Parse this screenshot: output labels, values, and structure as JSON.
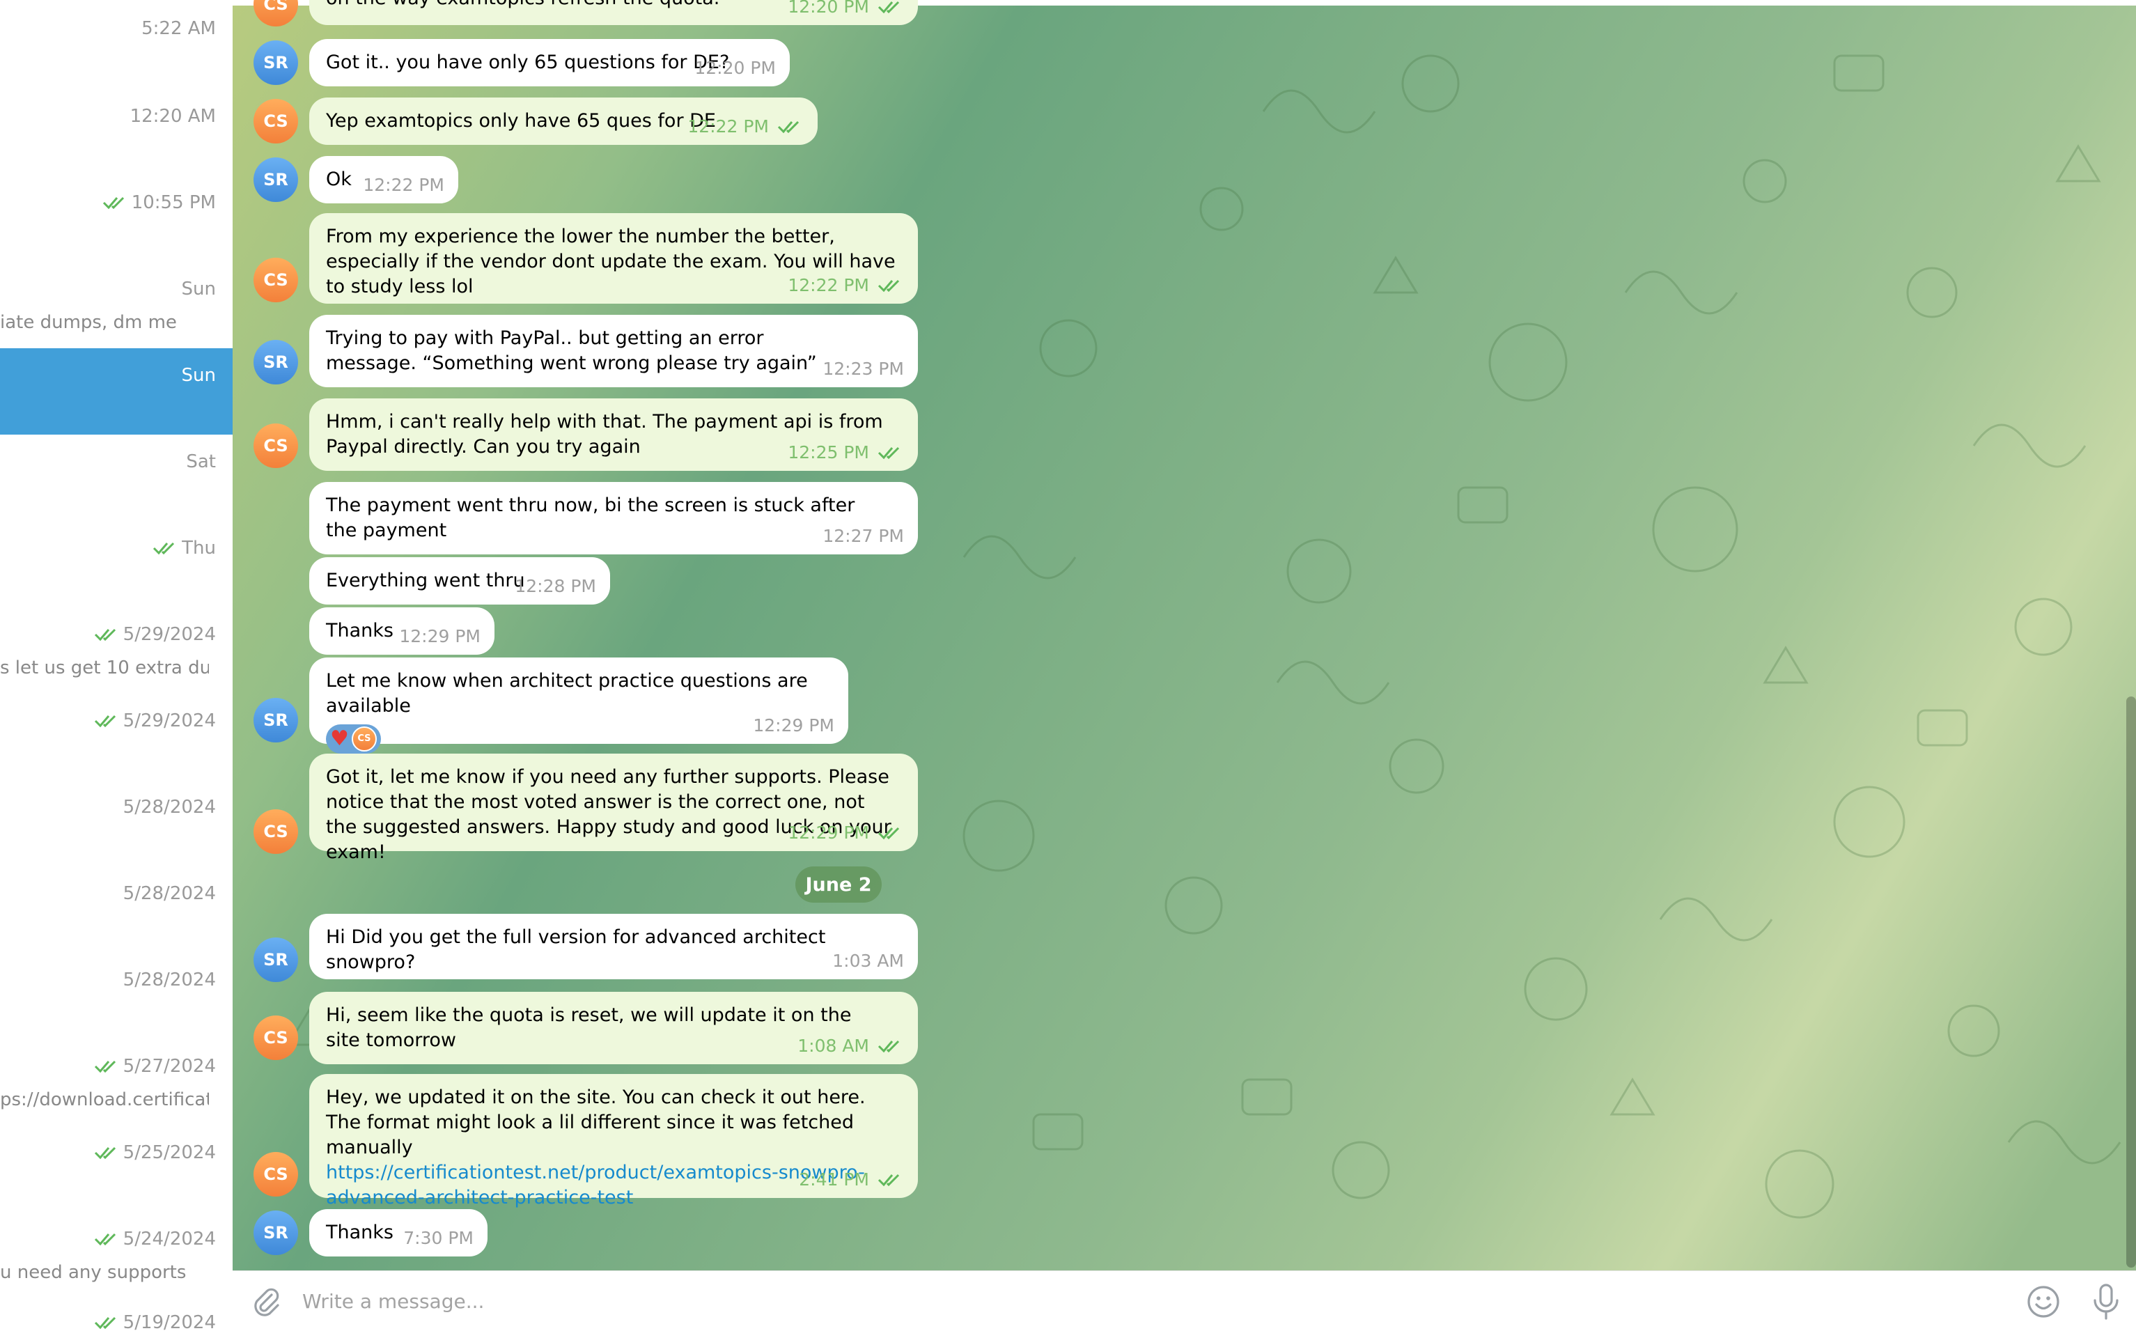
{
  "sidebar": {
    "chats": [
      {
        "time": "5:22 AM",
        "read": false,
        "snippet": ""
      },
      {
        "time": "12:20 AM",
        "read": false,
        "snippet": ""
      },
      {
        "time": "10:55 PM",
        "read": true,
        "snippet": ""
      },
      {
        "time": "Sun",
        "read": false,
        "snippet": "iate dumps, dm me"
      },
      {
        "time": "Sun",
        "read": false,
        "snippet": "",
        "active": true
      },
      {
        "time": "Sat",
        "read": false,
        "snippet": ""
      },
      {
        "time": "Thu",
        "read": true,
        "snippet": ""
      },
      {
        "time": "5/29/2024",
        "read": true,
        "snippet": "s let us get 10 extra du..."
      },
      {
        "time": "5/29/2024",
        "read": true,
        "snippet": ""
      },
      {
        "time": "5/28/2024",
        "read": false,
        "snippet": ""
      },
      {
        "time": "5/28/2024",
        "read": false,
        "snippet": ""
      },
      {
        "time": "5/28/2024",
        "read": false,
        "snippet": ""
      },
      {
        "time": "5/27/2024",
        "read": true,
        "snippet": "ps://download.certificati..."
      },
      {
        "time": "5/25/2024",
        "read": true,
        "snippet": ""
      },
      {
        "time": "5/24/2024",
        "read": true,
        "snippet": "u need any supports"
      },
      {
        "time": "5/19/2024",
        "read": true,
        "snippet": ""
      }
    ]
  },
  "chat": {
    "messages": [
      {
        "sender": "CS",
        "text": "on the way examtopics refresh the quota.",
        "time": "12:20 PM",
        "read": true
      },
      {
        "sender": "SR",
        "text": "Got it.. you have only 65 questions for DE?",
        "time": "12:20 PM"
      },
      {
        "sender": "CS",
        "text": "Yep examtopics only have 65 ques for DE",
        "time": "12:22 PM",
        "read": true
      },
      {
        "sender": "SR",
        "text": "Ok",
        "time": "12:22 PM"
      },
      {
        "sender": "CS",
        "text": "From my experience the lower the number the better, especially if the vendor dont update the exam. You will have to study less lol",
        "time": "12:22 PM",
        "read": true
      },
      {
        "sender": "SR",
        "text": "Trying to pay with PayPal.. but getting an error message. “Something went wrong please try again”",
        "time": "12:23 PM"
      },
      {
        "sender": "CS",
        "text": "Hmm, i can't really help with that. The payment api is from Paypal directly. Can you try again",
        "time": "12:25 PM",
        "read": true
      },
      {
        "sender": "SR",
        "text": "The payment went thru now, bi the screen is stuck after the payment",
        "time": "12:27 PM"
      },
      {
        "sender": "SR",
        "text": "Everything went thru",
        "time": "12:28 PM"
      },
      {
        "sender": "SR",
        "text": "Thanks",
        "time": "12:29 PM"
      },
      {
        "sender": "SR",
        "text": "Let me know when architect practice questions are available",
        "time": "12:29 PM",
        "reaction": {
          "emoji": "♥",
          "by": "CS"
        }
      },
      {
        "sender": "CS",
        "text": "Got it, let me know if you need any further supports. Please notice that the most voted answer is the correct one, not the suggested answers. Happy study and good luck on your exam!",
        "time": "12:29 PM",
        "read": true
      },
      {
        "sender": "SR",
        "text": "Hi Did you get the full version for advanced architect snowpro?",
        "time": "1:03 AM"
      },
      {
        "sender": "CS",
        "text": "Hi, seem like the quota is reset, we will update it on the site tomorrow",
        "time": "1:08 AM",
        "read": true
      },
      {
        "sender": "CS",
        "text": "Hey, we updated it on the site. You can check it out here. The format might look a lil different since it was fetched manually",
        "link": "https://certificationtest.net/product/examtopics-snowpro-advanced-architect-practice-test",
        "link_display": [
          "https://certificationtest.net/product/examtopics-snowpro-",
          "advanced-architect-practice-test"
        ],
        "time": "2:41 PM",
        "read": true
      },
      {
        "sender": "SR",
        "text": "Thanks",
        "time": "7:30 PM"
      }
    ],
    "date_separator": "June 2"
  },
  "composer": {
    "placeholder": "Write a message...",
    "attach_icon": "paperclip-icon",
    "emoji_icon": "smile-icon",
    "mic_icon": "microphone-icon"
  },
  "colors": {
    "accent": "#419fd9",
    "outgoing_bubble": "#eef8dc",
    "incoming_bubble": "#ffffff",
    "read_check": "#5fb85a",
    "avatar_sr": "#4a93e0",
    "avatar_cs": "#f5893f"
  }
}
